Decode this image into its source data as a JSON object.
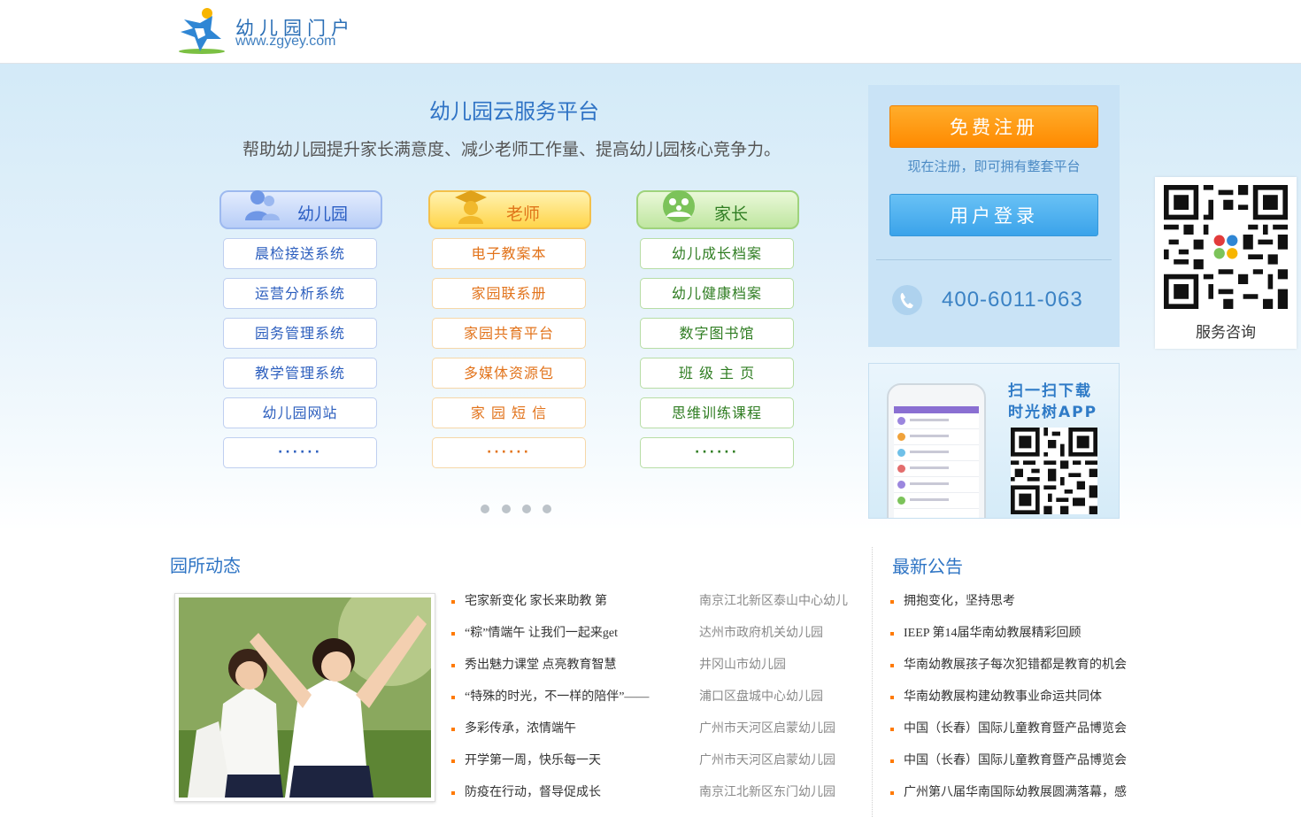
{
  "header": {
    "logo_title": "幼儿园门户",
    "logo_url": "www.zgyey.com"
  },
  "banner": {
    "title": "幼儿园云服务平台",
    "subtitle": "帮助幼儿园提升家长满意度、减少老师工作量、提高幼儿园核心竞争力。",
    "columns": [
      {
        "label": "幼儿园",
        "icon": "users-icon",
        "items": [
          "晨检接送系统",
          "运营分析系统",
          "园务管理系统",
          "教学管理系统",
          "幼儿园网站",
          "······"
        ]
      },
      {
        "label": "老师",
        "icon": "teacher-icon",
        "items": [
          "电子教案本",
          "家园联系册",
          "家园共育平台",
          "多媒体资源包",
          "家 园 短 信",
          "······"
        ]
      },
      {
        "label": "家长",
        "icon": "family-icon",
        "items": [
          "幼儿成长档案",
          "幼儿健康档案",
          "数字图书馆",
          "班 级 主 页",
          "思维训练课程",
          "······"
        ]
      }
    ],
    "pager_count": 4
  },
  "panel": {
    "register_label": "免费注册",
    "register_hint": "现在注册，即可拥有整套平台",
    "login_label": "用户登录",
    "phone": "400-6011-063",
    "phone_icon": "phone-icon"
  },
  "app": {
    "title_line1": "扫一扫下载",
    "title_line2": "时光树APP"
  },
  "service": {
    "label": "服务咨询"
  },
  "news": {
    "section_title": "园所动态",
    "items": [
      {
        "title": "宅家新变化 家长来助教 第",
        "school": "南京江北新区泰山中心幼儿"
      },
      {
        "title": "“粽”情端午 让我们一起来get",
        "school": "达州市政府机关幼儿园"
      },
      {
        "title": "秀出魅力课堂 点亮教育智慧",
        "school": "井冈山市幼儿园"
      },
      {
        "title": "“特殊的时光，不一样的陪伴”——",
        "school": "浦口区盘城中心幼儿园"
      },
      {
        "title": "多彩传承，浓情端午",
        "school": "广州市天河区启蒙幼儿园"
      },
      {
        "title": "开学第一周，快乐每一天",
        "school": "广州市天河区启蒙幼儿园"
      },
      {
        "title": "防疫在行动，督导促成长",
        "school": "南京江北新区东门幼儿园"
      }
    ]
  },
  "notices": {
    "section_title": "最新公告",
    "items": [
      "拥抱变化，坚持思考",
      "IEEP 第14届华南幼教展精彩回顾",
      "华南幼教展孩子每次犯错都是教育的机会",
      "华南幼教展构建幼教事业命运共同体",
      "中国（长春）国际儿童教育暨产品博览会",
      "中国（长春）国际儿童教育暨产品博览会",
      "广州第八届华南国际幼教展圆满落幕，感"
    ]
  },
  "colors": {
    "brand_blue": "#2e74c4",
    "register_orange": "#ff8a00",
    "login_blue": "#3aa3ea",
    "bullet_orange": "#ff7a00"
  }
}
